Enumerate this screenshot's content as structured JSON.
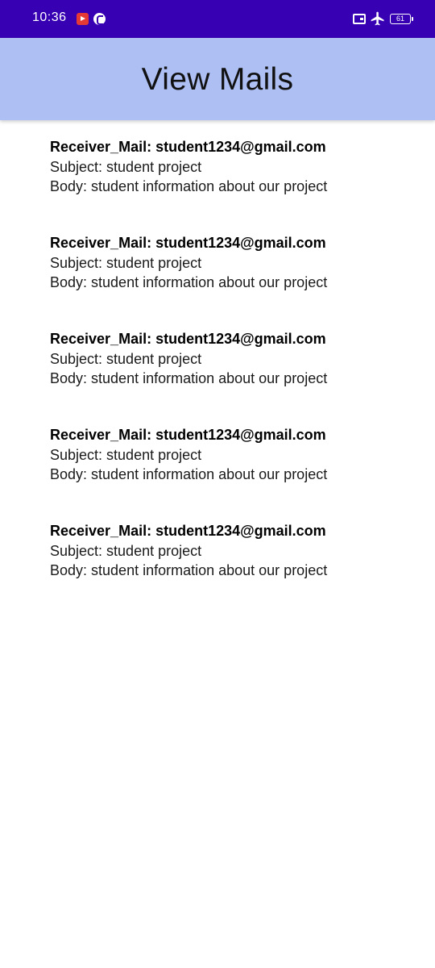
{
  "status_bar": {
    "time": "10:36",
    "battery": "61",
    "icons": [
      "youtube-icon",
      "phone-icon",
      "sim-icon",
      "airplane-icon",
      "battery-icon"
    ],
    "background": "#3700b3"
  },
  "app_bar": {
    "title": "View Mails",
    "background": "#aebff4"
  },
  "mails": [
    {
      "receiver": "Receiver_Mail: student1234@gmail.com",
      "subject": "Subject: student project",
      "body": "Body: student information about our project"
    },
    {
      "receiver": "Receiver_Mail: student1234@gmail.com",
      "subject": "Subject: student project",
      "body": "Body: student information about our project"
    },
    {
      "receiver": "Receiver_Mail: student1234@gmail.com",
      "subject": "Subject: student project",
      "body": "Body: student information about our project"
    },
    {
      "receiver": "Receiver_Mail: student1234@gmail.com",
      "subject": "Subject: student project",
      "body": "Body: student information about our project"
    },
    {
      "receiver": "Receiver_Mail: student1234@gmail.com",
      "subject": "Subject: student project",
      "body": "Body: student information about our project"
    }
  ]
}
